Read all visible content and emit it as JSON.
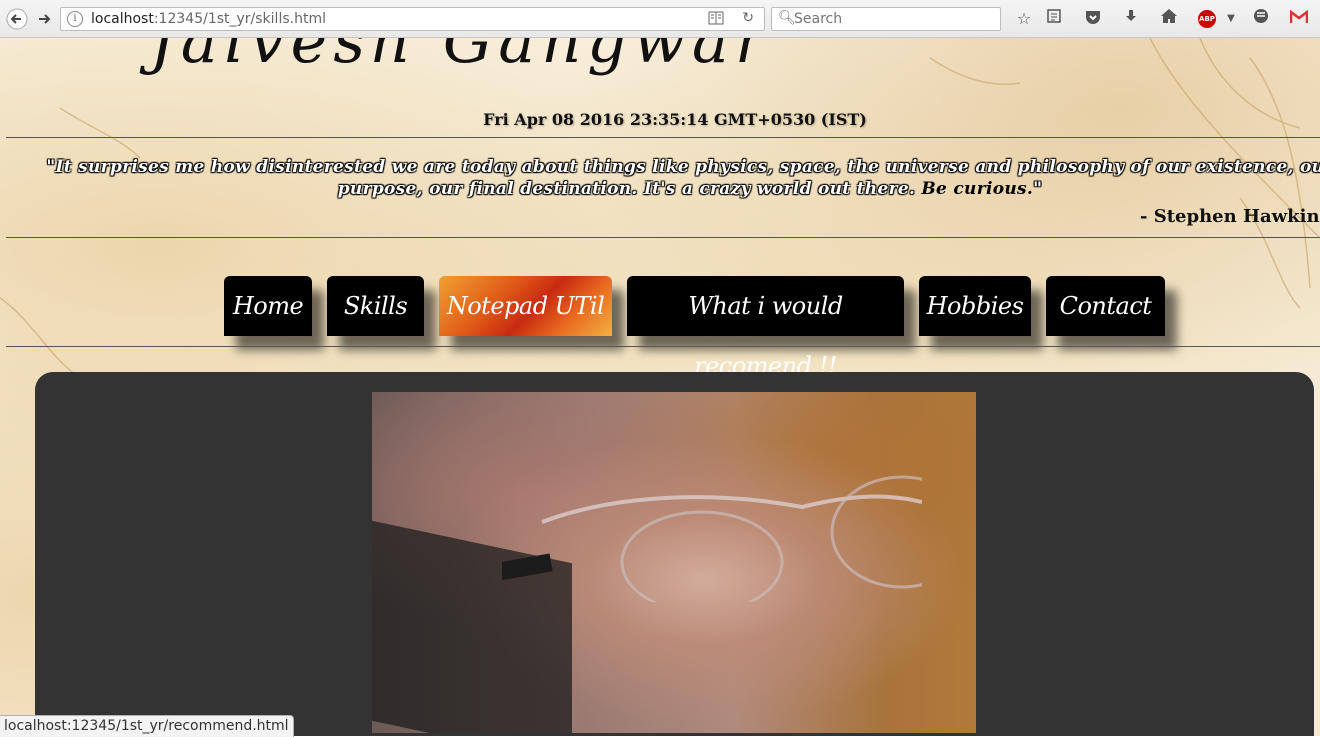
{
  "browser": {
    "url_host": "localhost",
    "url_rest": ":12345/1st_yr/skills.html",
    "search_placeholder": "Search",
    "abp_label": "ABP",
    "status_url": "localhost:12345/1st_yr/recommend.html"
  },
  "page": {
    "logo": "Jaivesh Gangwar",
    "datetime": "Fri Apr 08 2016 23:35:14 GMT+0530 (IST)",
    "quote_main": "\"It surprises me how disinterested we are today about things like physics, space, the universe and philosophy of our existence, our purpose, our final destination. It's a crazy world out there. ",
    "quote_emph": "Be curious.",
    "quote_close": "\"",
    "quote_author": "- Stephen Hawking",
    "nav": [
      {
        "label": "Home"
      },
      {
        "label": "Skills"
      },
      {
        "label": "Notepad UTil"
      },
      {
        "label": "What i would recomend !!"
      },
      {
        "label": "Hobbies"
      },
      {
        "label": "Contact"
      }
    ]
  }
}
